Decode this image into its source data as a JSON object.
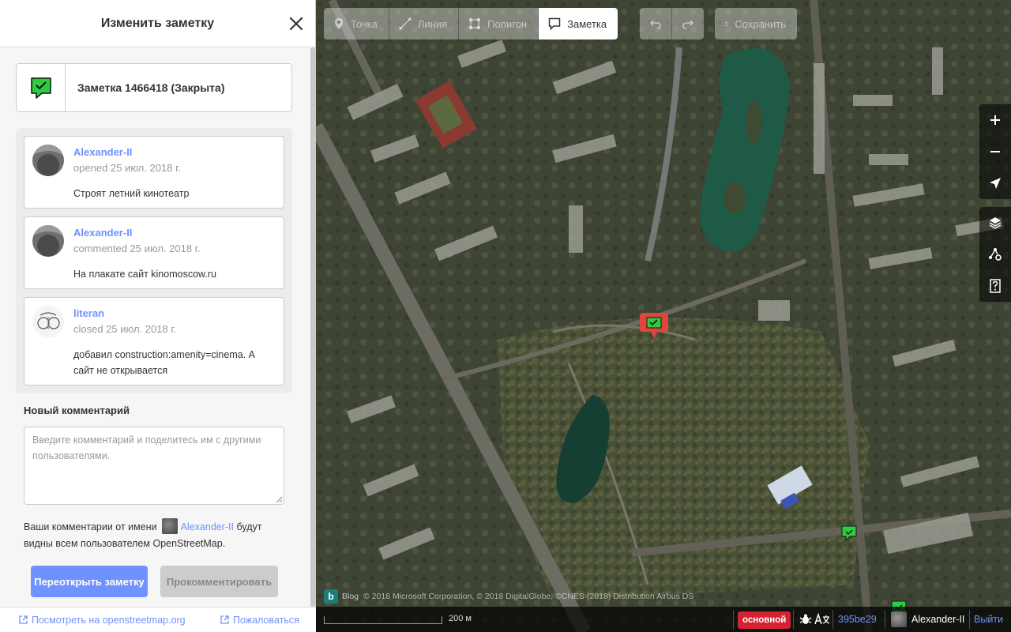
{
  "sidebar": {
    "title": "Изменить заметку",
    "note": {
      "title": "Заметка 1466418 (Закрыта)",
      "status_color": "#2ecc40"
    },
    "comments": [
      {
        "author": "Alexander-II",
        "meta": "opened 25 июл. 2018 г.",
        "text": "Строят летний кинотеатр"
      },
      {
        "author": "Alexander-II",
        "meta": "commented 25 июл. 2018 г.",
        "text": "На плакате сайт kinomoscow.ru"
      },
      {
        "author": "literan",
        "meta": "closed 25 июл. 2018 г.",
        "text": "добавил construction:amenity=cinema. А сайт не открывается"
      }
    ],
    "new_comment": {
      "label": "Новый комментарий",
      "placeholder": "Введите комментарий и поделитесь им с другими пользователями.",
      "value": ""
    },
    "author_info": {
      "before": "Ваши комментарии от имени",
      "user": "Alexander-II",
      "after": "будут видны всем пользователем OpenStreetMap."
    },
    "buttons": {
      "reopen": "Переоткрыть заметку",
      "comment": "Прокомментировать"
    },
    "footer": {
      "view_link": "Посмотреть на openstreetmap.org",
      "report_link": "Пожаловаться"
    }
  },
  "toolbar": {
    "modes": [
      {
        "label": "Точка",
        "icon": "point-icon"
      },
      {
        "label": "Линия",
        "icon": "line-icon"
      },
      {
        "label": "Полигон",
        "icon": "area-icon"
      },
      {
        "label": "Заметка",
        "icon": "note-icon",
        "active": true
      }
    ],
    "save": "Сохранить"
  },
  "map": {
    "attribution": {
      "blog": "Blog",
      "text": "© 2018 Microsoft Corporation, © 2018 DigitalGlobe, ©CNES (2018) Distribution Airbus DS"
    },
    "scale_label": "200 м",
    "background_badge": "основной",
    "version": "395be29",
    "user": "Alexander-II",
    "logout": "Выйти"
  },
  "colors": {
    "accent": "#7092ff",
    "note_closed": "#2ecc40",
    "note_selected": "#e0463b",
    "badge": "#d32232"
  }
}
